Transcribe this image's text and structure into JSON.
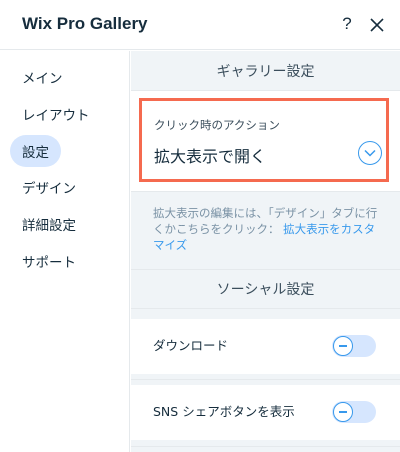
{
  "header": {
    "title": "Wix Pro Gallery",
    "help_label": "?",
    "close_icon": "close-icon"
  },
  "sidebar": {
    "items": [
      {
        "label": "メイン"
      },
      {
        "label": "レイアウト"
      },
      {
        "label": "設定",
        "active": true
      },
      {
        "label": "デザイン"
      },
      {
        "label": "詳細設定"
      },
      {
        "label": "サポート"
      }
    ]
  },
  "main": {
    "gallery_section_title": "ギャラリー設定",
    "click_action": {
      "label": "クリック時のアクション",
      "value": "拡大表示で開く",
      "dropdown_icon": "chevron-down-icon"
    },
    "info": {
      "text": "拡大表示の編集には、「デザイン」タブに行くかこちらをクリック：",
      "link": "拡大表示をカスタマイズ"
    },
    "social_section_title": "ソーシャル設定",
    "toggles": [
      {
        "label": "ダウンロード",
        "on": false
      },
      {
        "label": "SNS シェアボタンを表示",
        "on": false
      }
    ]
  },
  "colors": {
    "accent": "#3899ec",
    "highlight_border": "#f56a4f",
    "active_nav_bg": "#d6e6fe",
    "panel_bg": "#f0f4f7"
  }
}
